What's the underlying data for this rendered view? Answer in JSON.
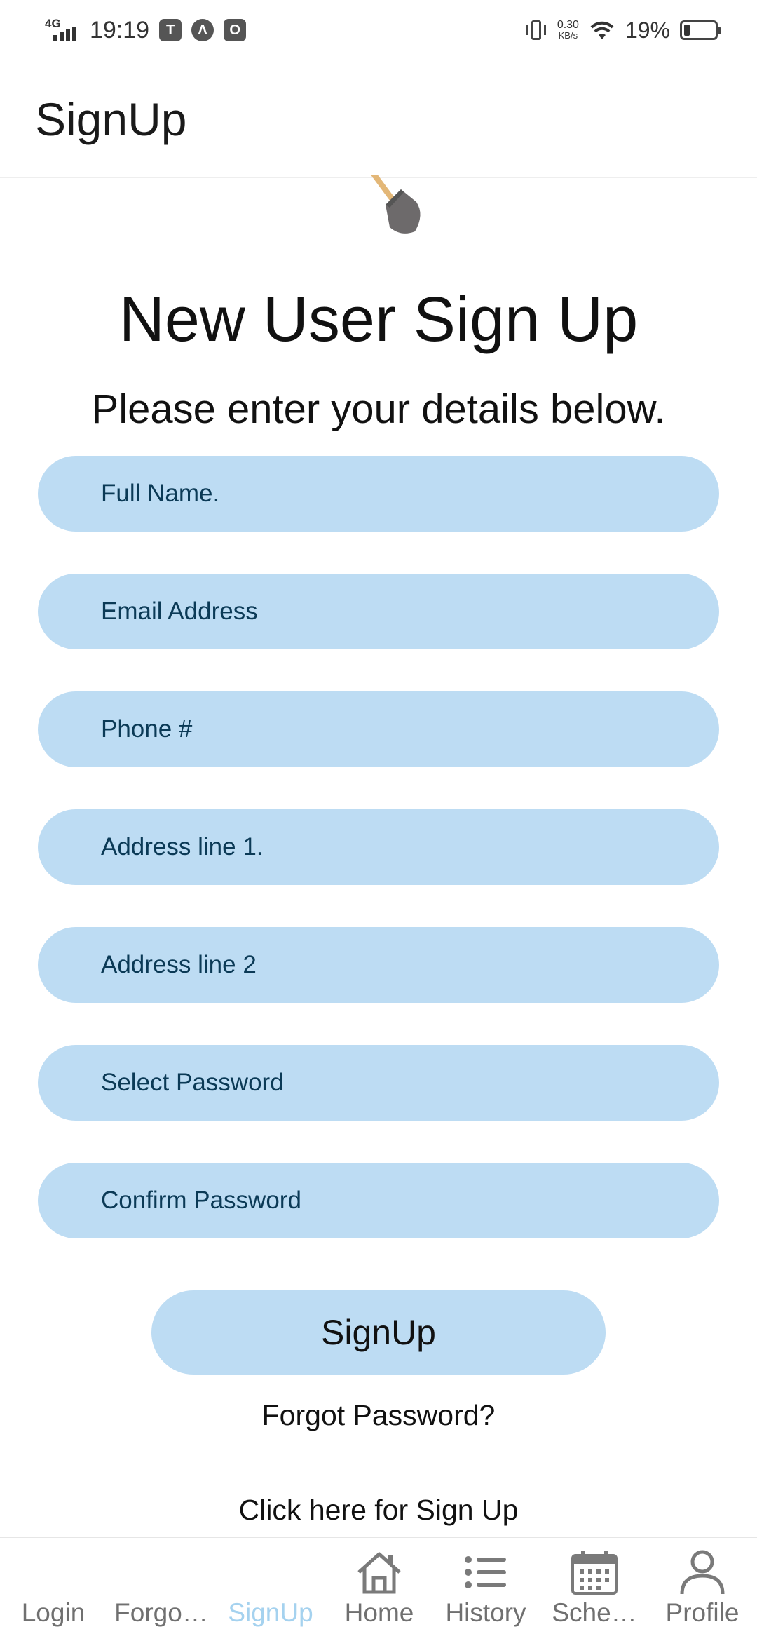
{
  "status_bar": {
    "network": "4G",
    "time": "19:19",
    "speed_value": "0.30",
    "speed_unit": "KB/s",
    "battery_percent": "19%",
    "battery_level": 0.19
  },
  "header": {
    "title": "SignUp"
  },
  "content": {
    "logo_icon": "shovel-icon",
    "heading": "New User Sign Up",
    "subheading": "Please enter your details below.",
    "fields": [
      {
        "placeholder": "Full Name.",
        "value": ""
      },
      {
        "placeholder": "Email Address",
        "value": ""
      },
      {
        "placeholder": "Phone #",
        "value": ""
      },
      {
        "placeholder": "Address line 1.",
        "value": ""
      },
      {
        "placeholder": "Address line 2",
        "value": ""
      },
      {
        "placeholder": "Select Password",
        "value": ""
      },
      {
        "placeholder": "Confirm Password",
        "value": ""
      }
    ],
    "signup_button": "SignUp",
    "forgot_password_link": "Forgot Password?",
    "signup_link": "Click here for Sign Up"
  },
  "bottom_nav": {
    "tabs": [
      {
        "label": "Login",
        "icon": "",
        "active": false
      },
      {
        "label": "Forgo…",
        "icon": "",
        "active": false
      },
      {
        "label": "SignUp",
        "icon": "",
        "active": true
      },
      {
        "label": "Home",
        "icon": "home-icon",
        "active": false
      },
      {
        "label": "History",
        "icon": "list-icon",
        "active": false
      },
      {
        "label": "Sche…",
        "icon": "calendar-icon",
        "active": false
      },
      {
        "label": "Profile",
        "icon": "person-icon",
        "active": false
      }
    ]
  },
  "colors": {
    "field_background": "#bddcf3",
    "field_text": "#0b3a56",
    "active_tab": "#a5d2ef",
    "inactive_tab": "#707070"
  }
}
